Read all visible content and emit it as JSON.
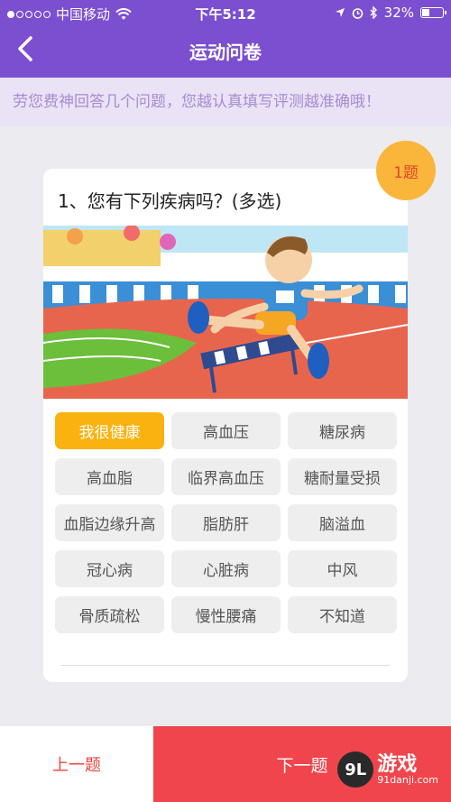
{
  "status_bar": {
    "carrier": "中国移动",
    "time": "下午5:12",
    "battery": "32%",
    "battery_level": 0.32
  },
  "nav": {
    "title": "运动问卷"
  },
  "banner": {
    "text": "劳您费神回答几个问题，您越认真填写评测越准确哦！"
  },
  "question": {
    "title": "1、您有下列疾病吗？(多选)",
    "badge": "1题",
    "options": [
      {
        "label": "我很健康",
        "selected": true
      },
      {
        "label": "高血压",
        "selected": false
      },
      {
        "label": "糖尿病",
        "selected": false
      },
      {
        "label": "高血脂",
        "selected": false
      },
      {
        "label": "临界高血压",
        "selected": false
      },
      {
        "label": "糖耐量受损",
        "selected": false
      },
      {
        "label": "血脂边缘升高",
        "selected": false
      },
      {
        "label": "脂肪肝",
        "selected": false
      },
      {
        "label": "脑溢血",
        "selected": false
      },
      {
        "label": "冠心病",
        "selected": false
      },
      {
        "label": "心脏病",
        "selected": false
      },
      {
        "label": "中风",
        "selected": false
      },
      {
        "label": "骨质疏松",
        "selected": false
      },
      {
        "label": "慢性腰痛",
        "selected": false
      },
      {
        "label": "不知道",
        "selected": false
      }
    ]
  },
  "footer": {
    "prev_label": "上一题",
    "next_label": "下一题"
  },
  "watermark": {
    "logo": "9L",
    "main": "游戏",
    "sub": "91danji.com"
  },
  "colors": {
    "primary": "#7b4fcf",
    "selected": "#f9b20f",
    "next": "#f0454c",
    "prev_text": "#e8463f"
  }
}
